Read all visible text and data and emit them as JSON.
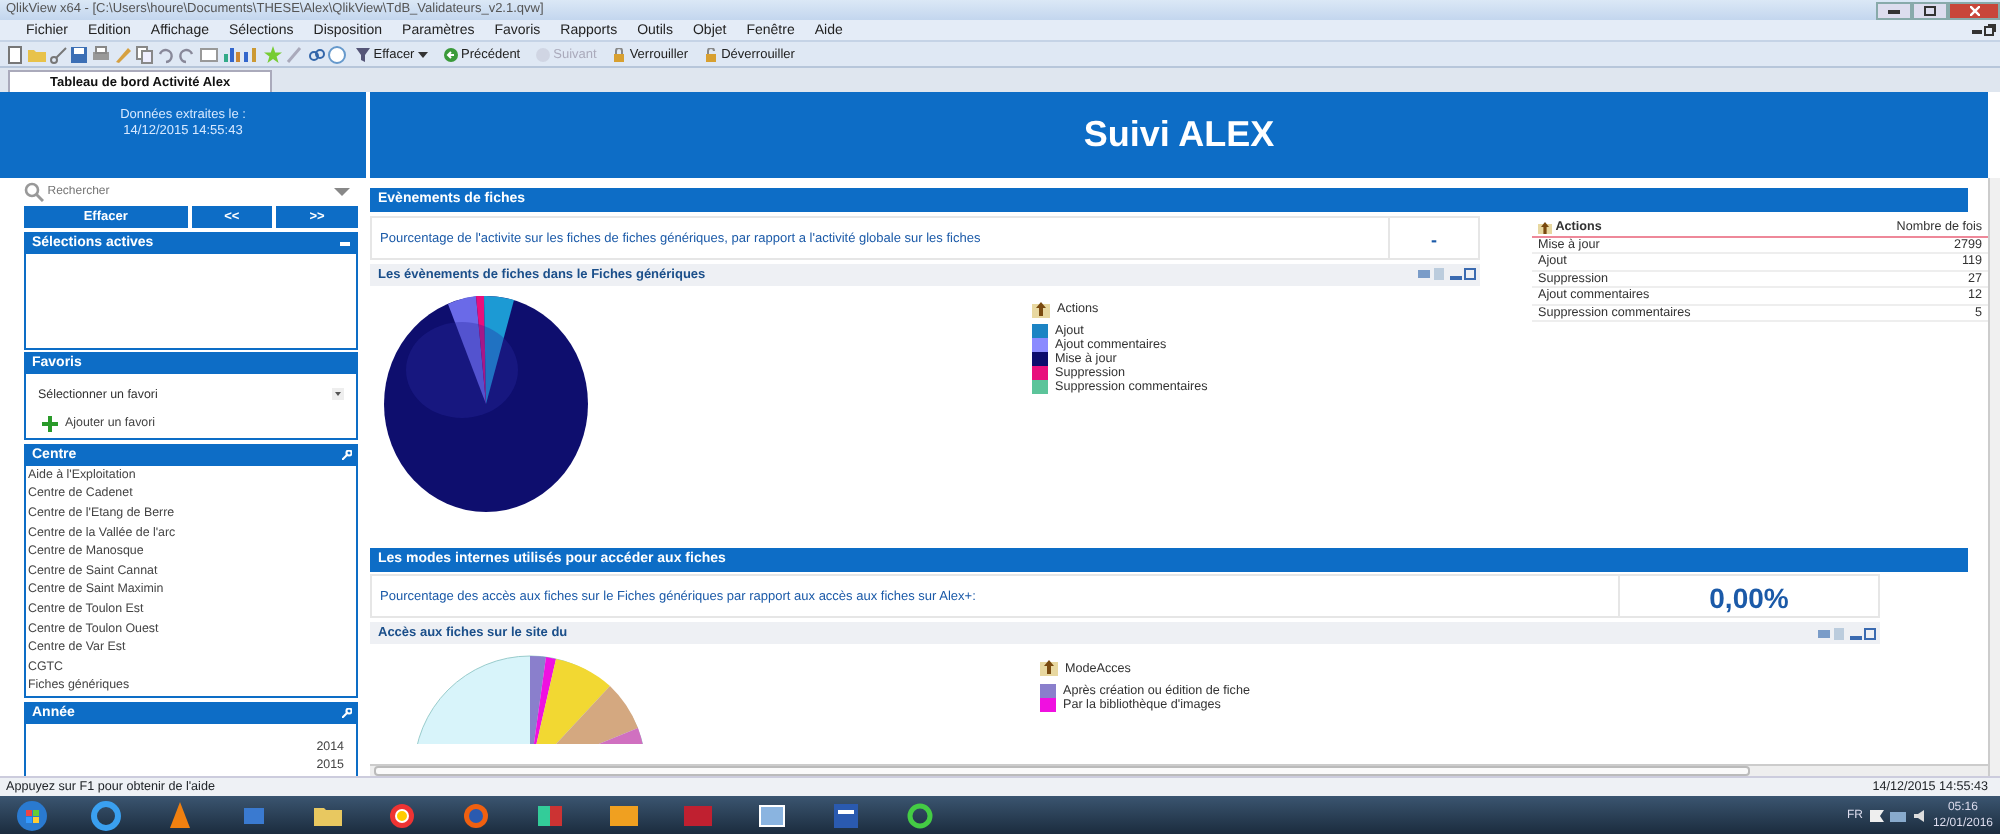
{
  "window": {
    "title": "QlikView x64 - [C:\\Users\\houre\\Documents\\THESE\\Alex\\QlikView\\TdB_Validateurs_v2.1.qvw]"
  },
  "menu": [
    "Fichier",
    "Edition",
    "Affichage",
    "Sélections",
    "Disposition",
    "Paramètres",
    "Favoris",
    "Rapports",
    "Outils",
    "Objet",
    "Fenêtre",
    "Aide"
  ],
  "toolbar": [
    {
      "label": "Effacer",
      "kind": "dropdown",
      "disabled": false
    },
    {
      "label": "Précédent",
      "kind": "plain",
      "disabled": false
    },
    {
      "label": "Suivant",
      "kind": "plain",
      "disabled": true
    },
    {
      "label": "Verrouiller",
      "kind": "plain",
      "disabled": false
    },
    {
      "label": "Déverrouiller",
      "kind": "plain",
      "disabled": false
    }
  ],
  "sheet_tabs": [
    {
      "label": "Tableau de bord Activité Alex",
      "selected": true
    }
  ],
  "header": {
    "extract_label": "Données extraites le :",
    "extract_date": "14/12/2015 14:55:43",
    "title": "Suivi ALEX"
  },
  "sidebar": {
    "search": {
      "placeholder": "Rechercher"
    },
    "buttons": [
      "Effacer",
      "<<",
      ">>"
    ],
    "active_selections": {
      "title": "Sélections actives"
    },
    "favorites": {
      "title": "Favoris",
      "select": "Sélectionner un favori",
      "add": "Ajouter un favori"
    },
    "listboxes": [
      {
        "title": "Centre",
        "items": [
          "Aide à l'Exploitation",
          "Centre de Cadenet",
          "Centre de l'Etang de Berre",
          "Centre de la Vallée de l'arc",
          "Centre de Manosque",
          "Centre de Saint Cannat",
          "Centre de Saint Maximin",
          "Centre de Toulon Est",
          "Centre de Toulon Ouest",
          "Centre de Var Est",
          "CGTC",
          "Fiches génériques"
        ]
      },
      {
        "title": "Année",
        "items": [
          "2014",
          "2015"
        ]
      }
    ]
  },
  "sections": [
    {
      "title": "Evènements de fiches",
      "kpi_text": "Pourcentage de l'activite sur les fiches de fiches génériques, par rapport a l'activité globale sur les fiches",
      "kpi_value": "-",
      "chart_title": "Les évènements de fiches dans le Fiches génériques",
      "legend_title": "Actions",
      "legend": [
        {
          "label": "Ajout",
          "color": "#1c84c4"
        },
        {
          "label": "Ajout commentaires",
          "color": "#8a8aff"
        },
        {
          "label": "Mise à jour",
          "color": "#0c0c6c"
        },
        {
          "label": "Suppression",
          "color": "#e8107c"
        },
        {
          "label": "Suppression commentaires",
          "color": "#5cc49a"
        }
      ],
      "table": {
        "columns": [
          "Actions",
          "Nombre de fois"
        ],
        "rows": [
          [
            "Mise à jour",
            "2799"
          ],
          [
            "Ajout",
            "119"
          ],
          [
            "Suppression",
            "27"
          ],
          [
            "Ajout commentaires",
            "12"
          ],
          [
            "Suppression commentaires",
            "5"
          ]
        ]
      }
    },
    {
      "title": "Les modes internes utilisés pour accéder aux fiches",
      "kpi_text": "Pourcentage des accès aux fiches sur le Fiches génériques par rapport aux accès aux fiches sur Alex+:",
      "kpi_value": "0,00%",
      "chart_title": "Accès aux fiches sur le site du",
      "legend_title": "ModeAcces",
      "legend": [
        {
          "label": "Après création ou édition de fiche",
          "color": "#8a7fcc"
        },
        {
          "label": "Par la bibliothèque d'images",
          "color": "#f010e0"
        }
      ]
    }
  ],
  "status_bar": {
    "help": "Appuyez sur F1 pour obtenir de l'aide",
    "timestamp": "14/12/2015 14:55:43"
  },
  "taskbar": {
    "language": "FR",
    "time": "05:16",
    "date": "12/01/2016"
  }
}
